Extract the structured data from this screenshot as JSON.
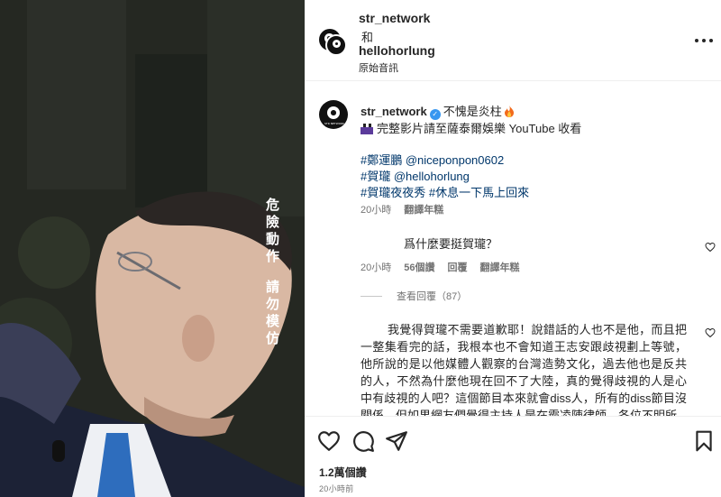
{
  "media": {
    "overlay_line1": "危險動作",
    "overlay_line2": "請勿模仿"
  },
  "header": {
    "account_primary": "str_network",
    "conjunction": "和",
    "account_secondary": "hellohorlung",
    "audio_label": "原始音訊",
    "avatar_text": "STR NETWORK",
    "more_icon": "more-horizontal-icon"
  },
  "caption": {
    "username": "str_network",
    "headline": "不愧是炎柱",
    "video_line": "完整影片請至薩泰爾娛樂 YouTube 收看",
    "tag_line1": [
      "#鄭運鵬",
      "@niceponpon0602"
    ],
    "tag_line2": [
      "#賀瓏",
      "@hellohorlung"
    ],
    "tag_line3": [
      "#賀瓏夜夜秀",
      "#休息一下馬上回來"
    ],
    "time": "20小時",
    "translate": "翻譯年糕"
  },
  "comments": [
    {
      "text": "爲什麼要挺賀瓏？",
      "time": "20小時",
      "likes": "56個讚",
      "reply_label": "回覆",
      "translate": "翻譯年糕",
      "view_replies": "查看回覆（87）"
    },
    {
      "text": "我覺得賀瓏不需要道歉耶！說錯話的人也不是他，而且把一整集看完的話，我根本也不會知道王志安跟歧視劃上等號，他所說的是以他媒體人觀察的台灣造勢文化，過去他也是反共的人，不然為什麼他現在回不了大陸，真的覺得歧視的人是心中有歧視的人吧？這個節目本來就會diss人，所有的diss節目沒關係，但如果網友們覺得主持人是在霸凌陳律師，各位不明所"
    }
  ],
  "actions": {
    "like_icon": "heart-icon",
    "comment_icon": "comment-icon",
    "share_icon": "paper-plane-icon",
    "save_icon": "bookmark-icon",
    "likes_count": "1.2萬個讚",
    "posted": "20小時前"
  },
  "colors": {
    "link": "#00376b",
    "verified": "#3897f0",
    "muted": "#737373"
  }
}
